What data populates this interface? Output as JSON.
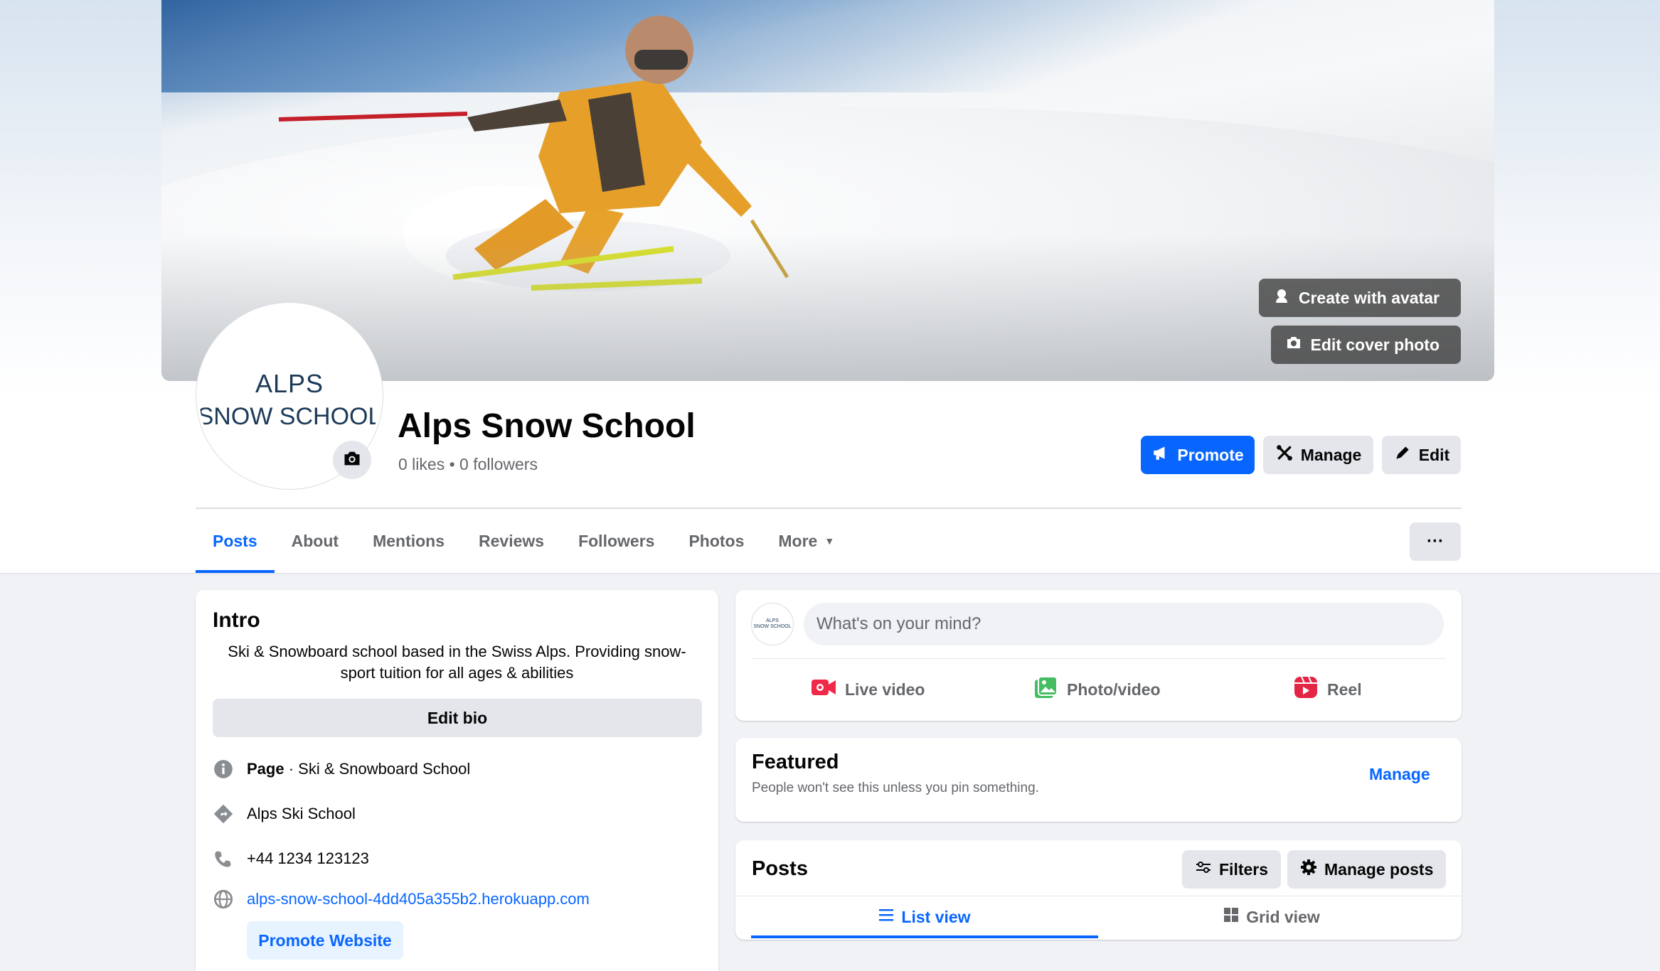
{
  "cover": {
    "create_avatar_label": "Create with avatar",
    "edit_cover_label": "Edit cover photo"
  },
  "profile": {
    "logo_line1": "ALPS",
    "logo_line2": "SNOW SCHOOL",
    "name": "Alps Snow School",
    "stats": "0 likes • 0 followers"
  },
  "actions": {
    "promote": "Promote",
    "manage": "Manage",
    "edit": "Edit"
  },
  "tabs": [
    {
      "label": "Posts",
      "active": true
    },
    {
      "label": "About"
    },
    {
      "label": "Mentions"
    },
    {
      "label": "Reviews"
    },
    {
      "label": "Followers"
    },
    {
      "label": "Photos"
    },
    {
      "label": "More"
    }
  ],
  "more_menu_label": "···",
  "intro": {
    "title": "Intro",
    "bio": "Ski & Snowboard school based in the Swiss Alps. Providing snow-sport tuition for all ages & abilities",
    "edit_bio": "Edit bio",
    "category_prefix": "Page",
    "category": " · Ski & Snowboard School",
    "address": "Alps Ski School",
    "phone": "+44 1234 123123",
    "website": "alps-snow-school-4dd405a355b2.herokuapp.com",
    "promote_website": "Promote Website"
  },
  "composer": {
    "avatar_line1": "ALPS",
    "avatar_line2": "SNOW SCHOOL",
    "placeholder": "What's on your mind?",
    "live_video": "Live video",
    "photo_video": "Photo/video",
    "reel": "Reel"
  },
  "featured": {
    "title": "Featured",
    "subtitle": "People won't see this unless you pin something.",
    "manage": "Manage"
  },
  "posts": {
    "title": "Posts",
    "filters": "Filters",
    "manage_posts": "Manage posts",
    "list_view": "List view",
    "grid_view": "Grid view"
  },
  "colors": {
    "accent": "#0866ff",
    "secondary_button": "#e4e6eb",
    "muted_text": "#65676b",
    "live_red": "#f02849",
    "photo_green": "#45bd62",
    "reel_pink": "#e42645"
  }
}
